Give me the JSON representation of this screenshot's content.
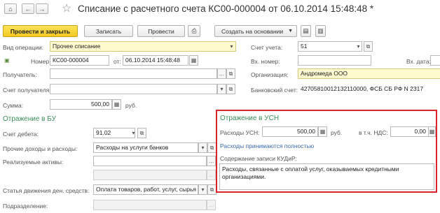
{
  "header": {
    "title": "Списание с расчетного счета КС00-000004 от 06.10.2014 15:48:48 *"
  },
  "toolbar": {
    "post_close_label": "Провести и закрыть",
    "save_label": "Записать",
    "post_label": "Провести",
    "create_based_label": "Создать на основании"
  },
  "form": {
    "operation_label": "Вид операции:",
    "operation_value": "Прочее списание",
    "account_label": "Счет учета:",
    "account_value": "51",
    "number_label": "Номер:",
    "number_value": "КС00-000004",
    "date_label": "от:",
    "date_value": "06.10.2014 15:48:48",
    "in_number_label": "Вх. номер:",
    "in_number_value": "",
    "in_date_label": "Вх. дата:",
    "in_date_value": "",
    "recipient_label": "Получатель:",
    "recipient_value": "",
    "org_label": "Организация:",
    "org_value": "Андромеда ООО",
    "recipient_account_label": "Счет получателя:",
    "recipient_account_value": "",
    "bank_account_label": "Банковский счет:",
    "bank_account_value": "42705810012132110000, ФСБ СБ РФ N 2317",
    "sum_label": "Сумма:",
    "sum_value": "500,00",
    "currency": "руб."
  },
  "bu": {
    "title": "Отражение в БУ",
    "debit_label": "Счет дебета:",
    "debit_value": "91.02",
    "income_label": "Прочие доходы и расходы:",
    "income_value": "Расходы на услуги банков",
    "assets_label": "Реализуемые активы:",
    "assets_value": "",
    "assets_value2": "",
    "cashflow_label": "Статья движения ден. средств:",
    "cashflow_value": "Оплата товаров, работ, услуг, сырья и и",
    "division_label": "Подразделение:",
    "division_value": ""
  },
  "usn": {
    "title": "Отражение в УСН",
    "expenses_label": "Расходы УСН:",
    "expenses_value": "500,00",
    "currency": "руб.",
    "vat_label": "в т.ч. НДС:",
    "vat_value": "0,00",
    "accepted_link": "Расходы принимаются полностью",
    "kudir_label": "Содержание записи КУДиР:",
    "kudir_text": "Расходы, связанные с оплатой услуг, оказываемых кредитными организациями."
  },
  "colors": {
    "primary_button": "#f5c81f",
    "section_title": "#3b8d5a",
    "highlight_frame": "#d9242c",
    "link": "#3a6aa8"
  }
}
